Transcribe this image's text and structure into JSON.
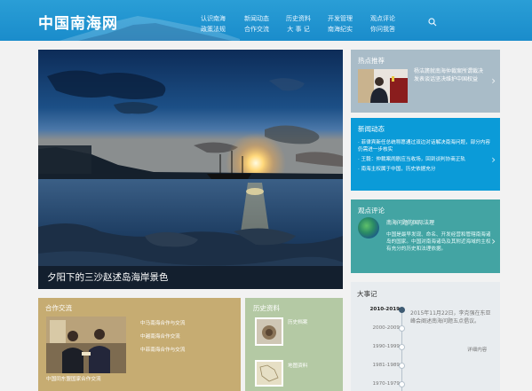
{
  "header": {
    "logo_text": "中国南海网",
    "nav": [
      [
        "认识南海",
        "政策法规"
      ],
      [
        "新闻动态",
        "合作交流"
      ],
      [
        "历史资料",
        "大 事 记"
      ],
      [
        "开发管理",
        "南海纪实"
      ],
      [
        "观点评论",
        "你问我答"
      ]
    ],
    "search_icon": "search-icon"
  },
  "hero": {
    "caption": "夕阳下的三沙赵述岛海岸景色"
  },
  "hot": {
    "title": "热点推荐",
    "text": "杨洁篪就南海仲裁案所谓裁决发表谈话坚决维护中国权益"
  },
  "news": {
    "title": "新闻动态",
    "items": [
      "· 菲律宾新任总统称愿通过双边对话解决南海问题，部分内容仍需进一步核实",
      "· 王毅：仲裁案闹剧应当收场，回到谈判协商正轨",
      "· 南海主权属于中国，历史依据充分"
    ]
  },
  "view": {
    "title": "观点评论",
    "subtitle": "南海问题的国际法理",
    "body": "中国是最早发现、命名、开发经营和管辖南海诸岛的国家。中国对南海诸岛及其附近海域的主权有充分的历史和法理依据。"
  },
  "coop": {
    "title": "合作交流",
    "links": [
      "中马南海合作与交流",
      "中越南海合作交流",
      "中菲南海合作与交流"
    ],
    "caption": "中国同东盟国家合作交流"
  },
  "hist": {
    "title": "历史资料",
    "item1": "历史档案",
    "item2": "地图资料"
  },
  "events": {
    "title": "大事记",
    "years": [
      "2010-2019",
      "2000-2009",
      "1990-1999",
      "1981-1989",
      "1970-1979"
    ],
    "desc": "2015年11月22日，李克强在东亚峰会阐述南海问题五点倡议。",
    "more": "详细内容"
  },
  "colors": {
    "header_blue": "#1a8ccb",
    "news_blue": "#0b9bd8",
    "view_teal": "#43a4a3",
    "coop_tan": "#c6ac72",
    "hist_green": "#b4c9a4"
  }
}
